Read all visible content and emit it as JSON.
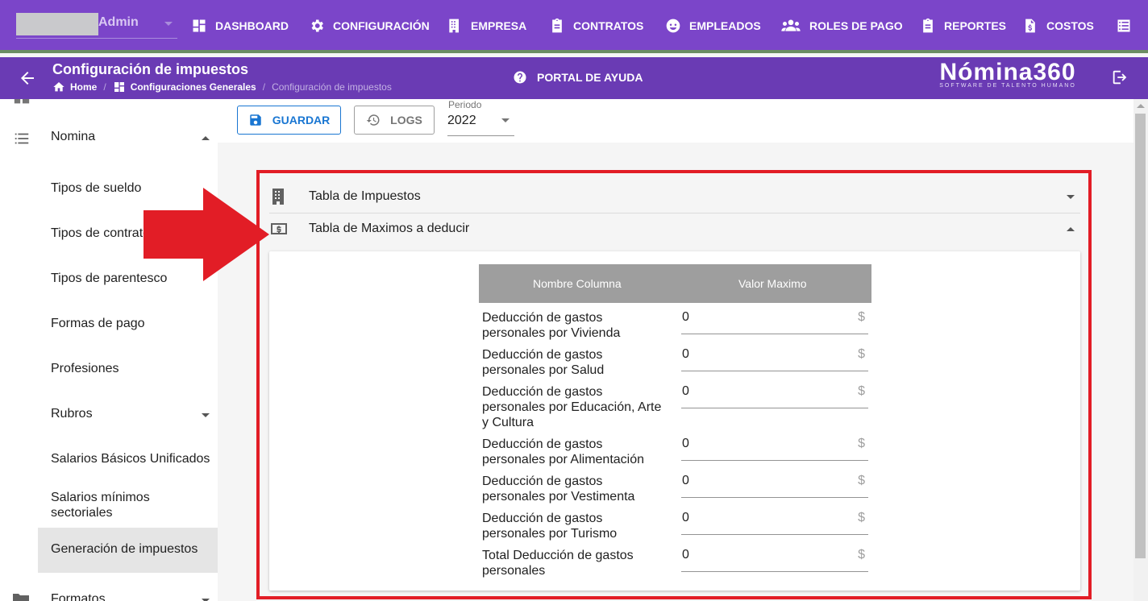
{
  "topnav": {
    "user_name": "Admin",
    "items": [
      {
        "label": "DASHBOARD",
        "icon": "dashboard-icon"
      },
      {
        "label": "CONFIGURACIÓN",
        "icon": "gear-icon"
      },
      {
        "label": "EMPRESA",
        "icon": "building-icon"
      },
      {
        "label": "CONTRATOS",
        "icon": "clipboard-icon"
      },
      {
        "label": "EMPLEADOS",
        "icon": "face-icon"
      },
      {
        "label": "ROLES DE PAGO",
        "icon": "group-icon"
      },
      {
        "label": "REPORTES",
        "icon": "clipboard-icon"
      },
      {
        "label": "COSTOS",
        "icon": "cost-file-icon"
      }
    ],
    "colors": {
      "bar": "#7b45c9",
      "subbar": "#6a3bb4"
    }
  },
  "header": {
    "title": "Configuración de impuestos",
    "breadcrumb": [
      "Home",
      "Configuraciones Generales",
      "Configuración de impuestos"
    ],
    "help_label": "PORTAL DE AYUDA",
    "brand": {
      "logo": "Nómina360",
      "tagline": "SOFTWARE DE TALENTO HUMANO"
    }
  },
  "sidebar": {
    "section": "Nomina",
    "items": [
      "Tipos de sueldo",
      "Tipos de contrato",
      "Tipos de parentesco",
      "Formas de pago",
      "Profesiones",
      "Rubros",
      "Salarios Básicos Unificados",
      "Salarios mínimos sectoriales",
      "Generación de impuestos"
    ],
    "next_section": "Formatos",
    "active_item": "Generación de impuestos"
  },
  "toolbar": {
    "save_label": "GUARDAR",
    "logs_label": "LOGS",
    "periodo_label": "Periodo",
    "periodo_value": "2022"
  },
  "panels": {
    "impuestos_title": "Tabla de Impuestos",
    "maximos_title": "Tabla de Maximos a deducir"
  },
  "table": {
    "headers": [
      "Nombre Columna",
      "Valor Maximo"
    ],
    "currency": "$",
    "rows": [
      {
        "name": "Deducción de gastos personales por Vivienda",
        "value": "0"
      },
      {
        "name": "Deducción de gastos personales por Salud",
        "value": "0"
      },
      {
        "name": "Deducción de gastos personales por Educación, Arte y Cultura",
        "value": "0"
      },
      {
        "name": "Deducción de gastos personales por Alimentación",
        "value": "0"
      },
      {
        "name": "Deducción de gastos personales por Vestimenta",
        "value": "0"
      },
      {
        "name": "Deducción de gastos personales por Turismo",
        "value": "0"
      },
      {
        "name": "Total Deducción de gastos personales",
        "value": "0"
      }
    ]
  },
  "annotation_color": "#e21d26"
}
